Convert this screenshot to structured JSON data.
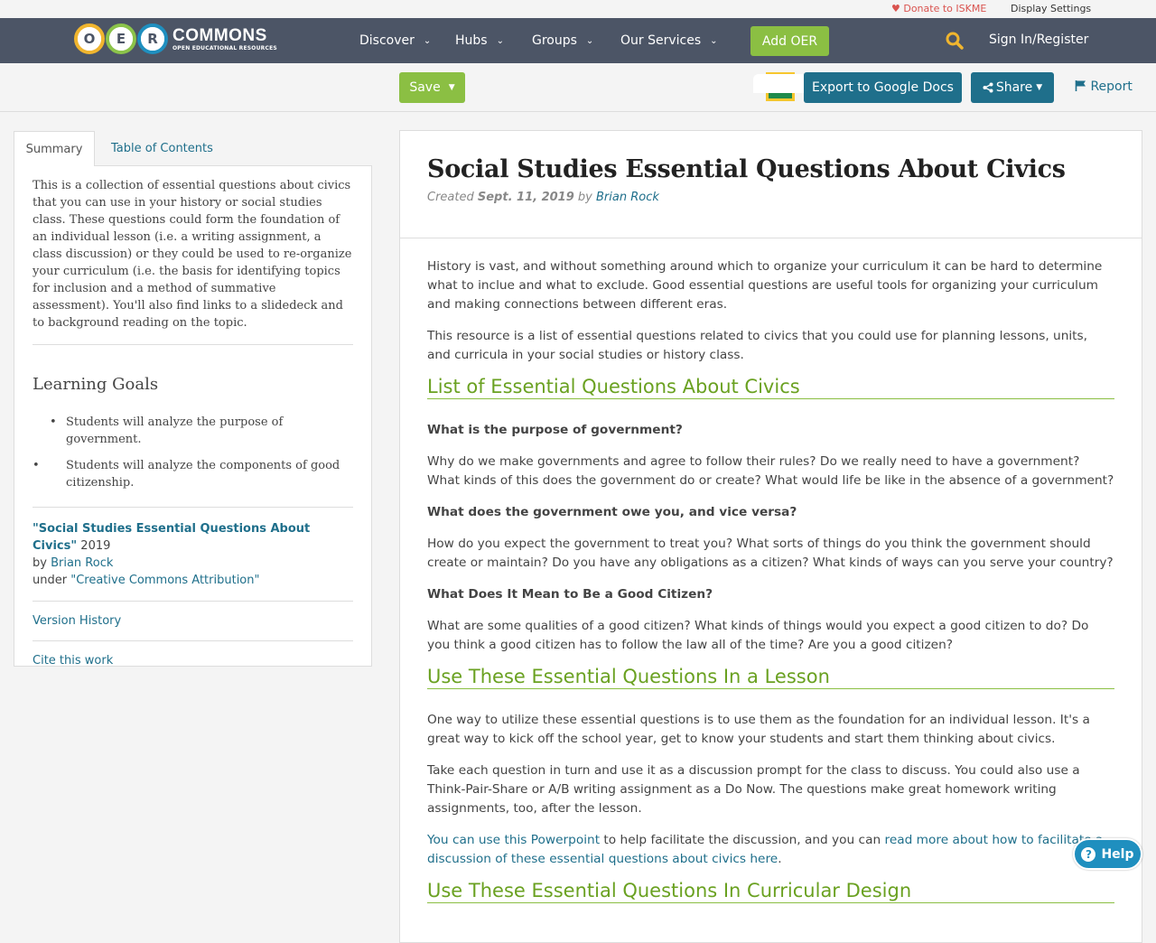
{
  "utility": {
    "donate_label": "♥ Donate to ISKME",
    "display_settings_label": "Display Settings"
  },
  "nav": {
    "logo_letters": [
      "O",
      "E",
      "R"
    ],
    "logo_word": "COMMONS",
    "logo_tagline": "OPEN EDUCATIONAL RESOURCES",
    "items": [
      {
        "label": "Discover"
      },
      {
        "label": "Hubs"
      },
      {
        "label": "Groups"
      },
      {
        "label": "Our Services"
      }
    ],
    "add_oer_label": "Add OER",
    "signin_label": "Sign In/Register"
  },
  "actions": {
    "save_label": "Save",
    "export_label": "Export to Google Docs",
    "share_label": "Share",
    "report_label": "Report"
  },
  "left": {
    "tabs": [
      "Summary",
      "Table of Contents"
    ],
    "summary": "This is a collection of essential questions about civics that you can use in your history or social studies class. These questions could form the foundation of an individual lesson (i.e. a writing assignment, a class discussion) or they could be used to re-organize your curriculum (i.e. the basis for identifying topics for inclusion and a method of summative assessment). You'll also find links to a slidedeck and to background reading on the topic.",
    "learning_goals_title": "Learning Goals",
    "goals": [
      "Students will analyze the purpose of government.",
      "Students will analyze the components of good citizenship."
    ],
    "attribution": {
      "title": "\"Social Studies Essential Questions About Civics\"",
      "year": "2019",
      "by": "by",
      "author": "Brian Rock",
      "under": "under",
      "license": "\"Creative Commons Attribution\""
    },
    "version_history": "Version History",
    "cite": "Cite this work"
  },
  "main": {
    "title": "Social Studies Essential Questions About Civics",
    "created_prefix": "Created",
    "created_date": "Sept. 11, 2019",
    "by": "by",
    "author": "Brian Rock",
    "p1": "History is vast, and without something around which to organize your curriculum it can be hard to determine what to inclue and what to exclude. Good essential questions are useful tools for organizing your curriculum and making connections between different eras.",
    "p2": "This resource is a list of essential questions related to civics that you could use for planning lessons, units, and curricula in your social studies or history class.",
    "h_list": "List of Essential Questions About Civics",
    "q1": "What is the purpose of government?",
    "a1": "Why do we make governments and agree to follow their rules? Do we really need to have a government? What kinds of this does the government do or create? What would life be like in the absence of a government?",
    "q2": "What does the government owe you, and vice versa?",
    "a2": "How do you expect the government to treat you? What sorts of things do you think the government should create or maintain? Do you have any obligations as a citizen? What kinds of ways can you serve your country?",
    "q3": "What Does It Mean to Be a Good Citizen?",
    "a3": "What are some qualities of a good citizen? What kinds of things would you expect a good citizen to do? Do you think a good citizen has to follow the law all of the time? Are you a good citizen?",
    "h_lesson": "Use These Essential Questions In a Lesson",
    "p3": "One way to utilize these essential questions is to use them as the foundation for an individual lesson. It's a great way to kick off the school year, get to know your students and start them thinking about civics.",
    "p4": "Take each question in turn and use it as a discussion prompt for the class to discuss. You could also use a Think-Pair-Share or A/B writing assignment as a Do Now. The questions make great homework writing assignments, too, after the lesson.",
    "p5_link1": "You can use this Powerpoint",
    "p5_mid": " to help facilitate the discussion, and you can ",
    "p5_link2": "read more about how to facilitate a discussion of these essential questions about civics here",
    "p5_end": ".",
    "h_design": "Use These Essential Questions In Curricular Design"
  },
  "help_label": "Help",
  "colors": {
    "nav_bg": "#4c5566",
    "green": "#8bbf43",
    "teal": "#1f6f8b",
    "heading_green": "#6aa121"
  }
}
